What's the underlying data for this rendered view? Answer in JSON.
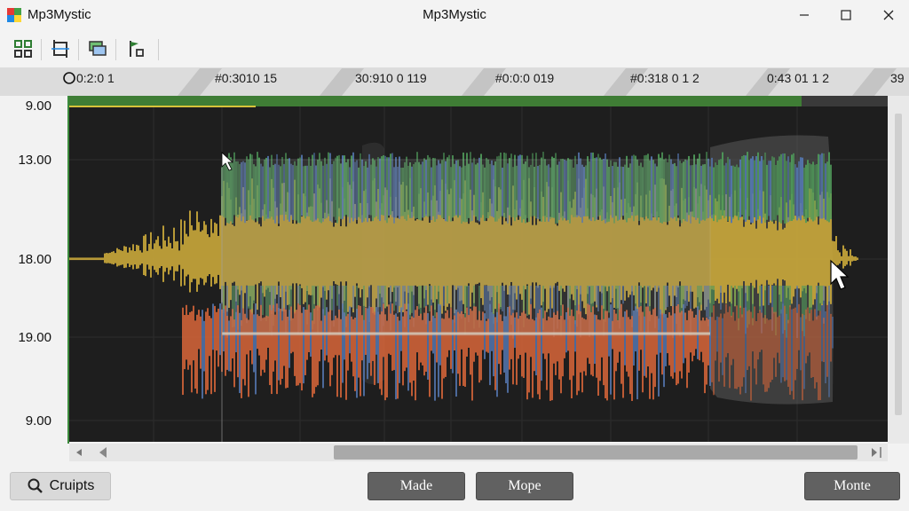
{
  "window": {
    "app_name": "Mp3Mystic",
    "title": "Mp3Mystic"
  },
  "controls": {
    "minimize": "minimize",
    "maximize": "maximize",
    "close": "close"
  },
  "toolbar": {
    "tools": [
      {
        "name": "grid-tool-icon"
      },
      {
        "name": "crop-tool-icon"
      },
      {
        "name": "layers-tool-icon"
      },
      {
        "name": "flag-tool-icon"
      }
    ]
  },
  "timeline": {
    "labels": [
      "0:2:0 1",
      "#0:3010 15",
      "30:910 0 119",
      "#0:0:0 019",
      "#0:318 0 1 2",
      "0:43 01 1 2",
      "39"
    ]
  },
  "yaxis": {
    "labels": [
      "9.00",
      "13.00",
      "18.00",
      "19.00",
      "9.00"
    ]
  },
  "colors": {
    "waveform_yellow": "#c9a83a",
    "waveform_green": "#4f9a5a",
    "waveform_blue": "#5577b0",
    "waveform_orange": "#d9663a",
    "progress_green": "#3f7d35",
    "plot_bg": "#1e1e1e"
  },
  "buttons": {
    "search_label": "Cruipts",
    "made_label": "Made",
    "mope_label": "Mope",
    "monte_label": "Monte"
  }
}
